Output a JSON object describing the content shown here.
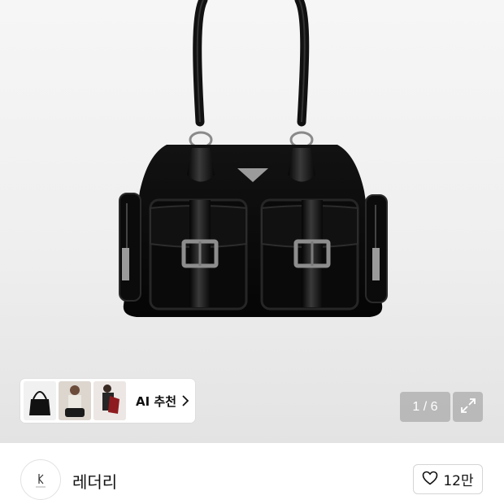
{
  "product_image": {
    "icon": "handbag-photo",
    "ai_recommend": {
      "label": "AI 추천",
      "thumbnails": [
        "black-bag-thumbnail",
        "model-photo-thumbnail",
        "red-bag-thumbnail"
      ]
    },
    "pagination": {
      "text": "1 / 6",
      "current": 1,
      "total": 6
    },
    "expand_icon": "expand-arrows-icon"
  },
  "brand": {
    "name": "레더리",
    "logo_icon": "brand-logo-icon"
  },
  "like": {
    "count": "12만",
    "icon": "heart-outline-icon"
  },
  "colors": {
    "background_top": "#f6f6f6",
    "background_bottom": "#e3e3e3",
    "counter_bg": "#969696",
    "text": "#111111"
  }
}
